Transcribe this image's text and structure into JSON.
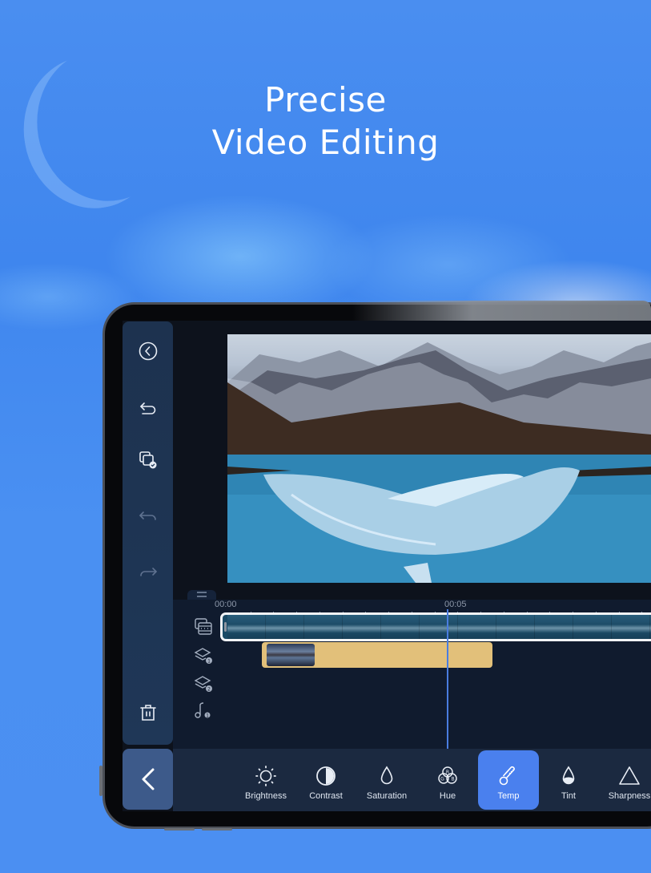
{
  "headline": {
    "line1": "Precise",
    "line2": "Video Editing"
  },
  "sidebar": {
    "items": [
      {
        "name": "exit",
        "icon": "circle-chevron-left-icon",
        "enabled": true
      },
      {
        "name": "back",
        "icon": "return-arrow-icon",
        "enabled": true
      },
      {
        "name": "copy",
        "icon": "copy-check-icon",
        "enabled": true
      },
      {
        "name": "undo",
        "icon": "undo-icon",
        "enabled": false
      },
      {
        "name": "redo",
        "icon": "redo-icon",
        "enabled": false
      },
      {
        "name": "delete",
        "icon": "trash-icon",
        "enabled": true
      }
    ]
  },
  "timeline": {
    "time_marks": [
      "00:00",
      "00:05"
    ],
    "tracks": [
      {
        "name": "video",
        "icon": "video-track-icon"
      },
      {
        "name": "layer-1",
        "icon": "layer-icon",
        "badge": "1"
      },
      {
        "name": "layer-2",
        "icon": "layer-icon",
        "badge": "2"
      },
      {
        "name": "audio-1",
        "icon": "music-note-icon",
        "badge": "1"
      }
    ]
  },
  "toolbar": {
    "back_icon": "chevron-left-icon",
    "tools": [
      {
        "label": "Brightness",
        "icon": "sun-icon",
        "active": false
      },
      {
        "label": "Contrast",
        "icon": "contrast-icon",
        "active": false
      },
      {
        "label": "Saturation",
        "icon": "drop-icon",
        "active": false
      },
      {
        "label": "Hue",
        "icon": "rgb-icon",
        "active": false
      },
      {
        "label": "Temp",
        "icon": "thermometer-icon",
        "active": true
      },
      {
        "label": "Tint",
        "icon": "tint-icon",
        "active": false
      },
      {
        "label": "Sharpness",
        "icon": "triangle-icon",
        "active": false
      }
    ]
  },
  "colors": {
    "accent": "#4a80ee",
    "overlay_clip": "#e2c07a",
    "playhead": "#4a7de0",
    "panel": "#1d324f"
  }
}
